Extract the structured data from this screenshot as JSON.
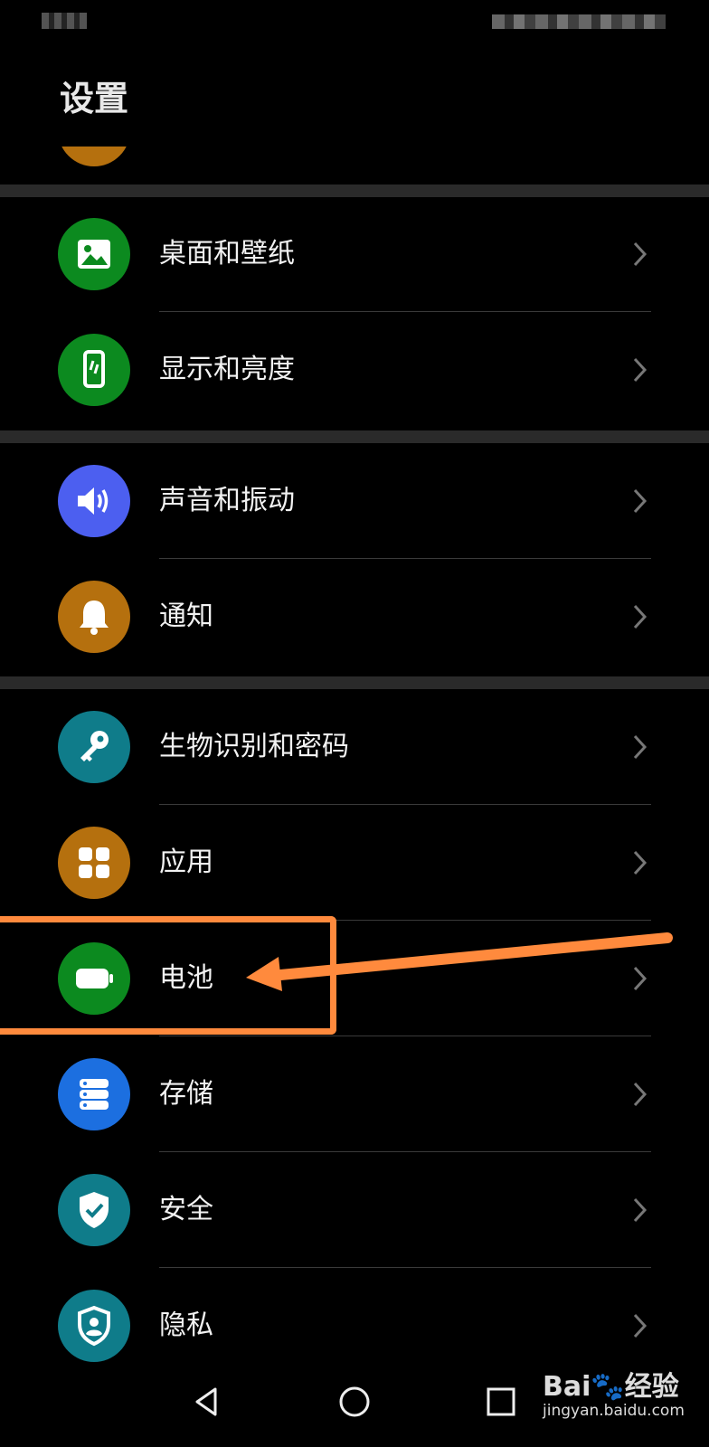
{
  "header": {
    "title": "设置"
  },
  "items": [
    {
      "label": "桌面和壁纸",
      "icon": "wallpaper-icon",
      "color": "#0c8a1f"
    },
    {
      "label": "显示和亮度",
      "icon": "display-icon",
      "color": "#0c8a1f"
    },
    {
      "label": "声音和振动",
      "icon": "speaker-icon",
      "color": "#4c5ff0"
    },
    {
      "label": "通知",
      "icon": "bell-icon",
      "color": "#b5700e"
    },
    {
      "label": "生物识别和密码",
      "icon": "key-icon",
      "color": "#0f7c8a"
    },
    {
      "label": "应用",
      "icon": "apps-grid-icon",
      "color": "#b5700e"
    },
    {
      "label": "电池",
      "icon": "battery-icon",
      "color": "#0c8a1f"
    },
    {
      "label": "存储",
      "icon": "storage-icon",
      "color": "#1c6fe0"
    },
    {
      "label": "安全",
      "icon": "shield-check-icon",
      "color": "#0f7c8a"
    },
    {
      "label": "隐私",
      "icon": "privacy-shield-icon",
      "color": "#0f7c8a"
    }
  ],
  "annotation": {
    "highlight_color": "#ff8a3d",
    "highlighted_item": "电池"
  },
  "watermark": {
    "logo": "Bai🐾经验",
    "url": "jingyan.baidu.com"
  },
  "navbar": {
    "buttons": [
      "back-icon",
      "home-icon",
      "recents-icon"
    ]
  }
}
